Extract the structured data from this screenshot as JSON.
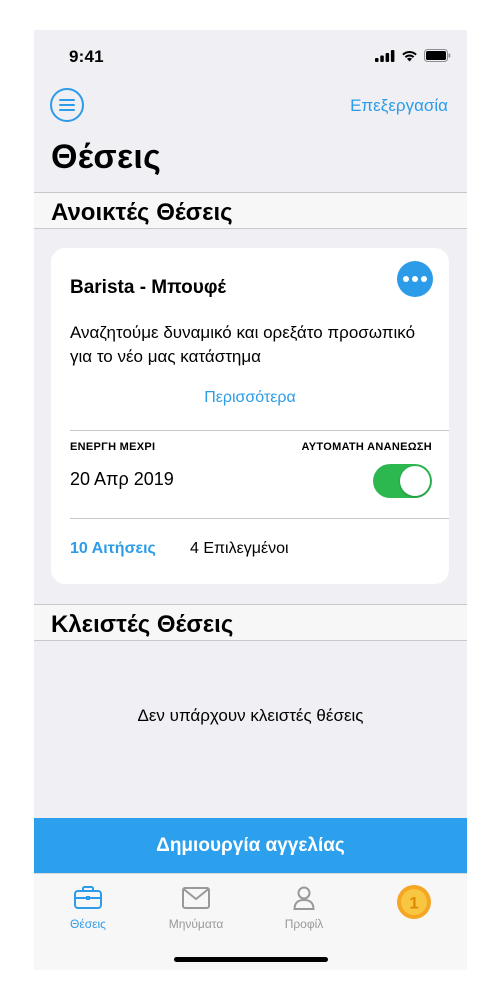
{
  "status_bar": {
    "time": "9:41"
  },
  "nav": {
    "edit_label": "Επεξεργασία"
  },
  "page_title": "Θέσεις",
  "sections": {
    "open": "Ανοικτές Θέσεις",
    "closed": "Κλειστές Θέσεις"
  },
  "job_card": {
    "title": "Barista - Μπουφέ",
    "description": "Αναζητούμε δυναμικό και ορεξάτο προσωπικό για το νέο μας κατάστημα",
    "more_label": "Περισσότερα",
    "active_until_label": "ΕΝΕΡΓΗ ΜΕΧΡΙ",
    "active_until_value": "20 Απρ 2019",
    "auto_renew_label": "ΑΥΤΟΜΑΤΗ ΑΝΑΝΕΩΣΗ",
    "auto_renew_on": true,
    "applications": "10 Αιτήσεις",
    "selected": "4 Επιλεγμένοι"
  },
  "closed_empty_message": "Δεν υπάρχουν κλειστές θέσεις",
  "create_button": "Δημιουργία αγγελίας",
  "tabs": [
    {
      "label": "Θέσεις",
      "icon": "briefcase-icon",
      "active": true
    },
    {
      "label": "Μηνύματα",
      "icon": "envelope-icon",
      "active": false
    },
    {
      "label": "Προφίλ",
      "icon": "person-icon",
      "active": false
    }
  ],
  "coin_badge": "1",
  "colors": {
    "accent": "#2c9ce8",
    "toggle_on": "#2cb84f",
    "background": "#efeff4"
  }
}
